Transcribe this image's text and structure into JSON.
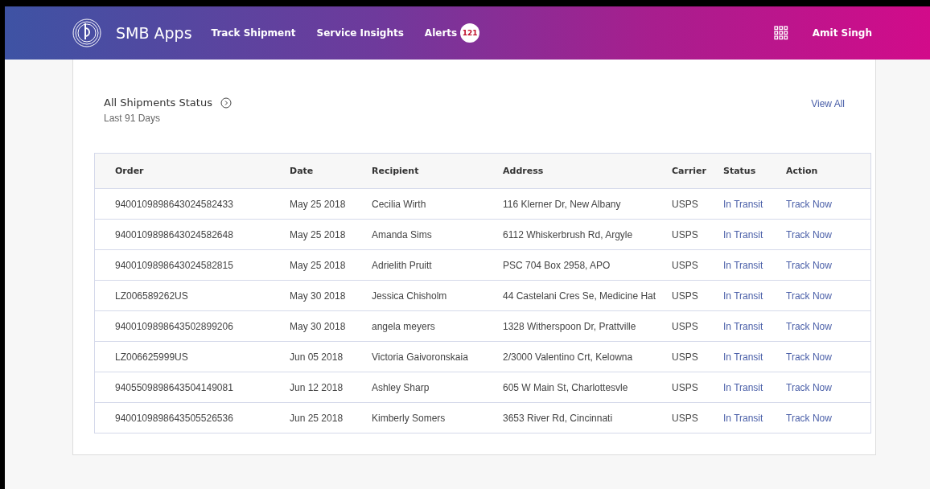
{
  "header": {
    "app_name": "SMB Apps",
    "nav": [
      {
        "label": "Track Shipment",
        "selected": false
      },
      {
        "label": "Service Insights",
        "selected": false
      },
      {
        "label": "Alerts",
        "selected": false,
        "badge": "121"
      }
    ],
    "user": "Amit Singh"
  },
  "panel": {
    "title": "All Shipments Status",
    "subtitle": "Last 91 Days",
    "link": "View All"
  },
  "table": {
    "columns": [
      "Order",
      "Date",
      "Recipient",
      "Address",
      "Carrier",
      "Status",
      "Action"
    ],
    "rows": [
      [
        "9400109898643024582433",
        "May 25 2018",
        "Cecilia Wirth",
        "116 Klerner Dr, New Albany",
        "USPS",
        "In Transit",
        "Track Now"
      ],
      [
        "9400109898643024582648",
        "May 25 2018",
        "Amanda Sims",
        "6112 Whiskerbrush Rd, Argyle",
        "USPS",
        "In Transit",
        "Track Now"
      ],
      [
        "9400109898643024582815",
        "May 25 2018",
        "Adrielith Pruitt",
        "PSC 704 Box 2958, APO",
        "USPS",
        "In Transit",
        "Track Now"
      ],
      [
        "LZ006589262US",
        "May 30 2018",
        "Jessica Chisholm",
        "44 Castelani Cres Se, Medicine Hat",
        "USPS",
        "In Transit",
        "Track Now"
      ],
      [
        "9400109898643502899206",
        "May 30 2018",
        "angela meyers",
        "1328 Witherspoon Dr, Prattville",
        "USPS",
        "In Transit",
        "Track Now"
      ],
      [
        "LZ006625999US",
        "Jun 05 2018",
        "Victoria Gaivoronskaia",
        "2/3000 Valentino Crt, Kelowna",
        "USPS",
        "In Transit",
        "Track Now"
      ],
      [
        "9405509898643504149081",
        "Jun 12 2018",
        "Ashley Sharp",
        "605 W Main St, Charlottesvle",
        "USPS",
        "In Transit",
        "Track Now"
      ],
      [
        "9400109898643505526536",
        "Jun 25 2018",
        "Kimberly Somers",
        "3653 River Rd, Cincinnati",
        "USPS",
        "In Transit",
        "Track Now"
      ]
    ]
  }
}
